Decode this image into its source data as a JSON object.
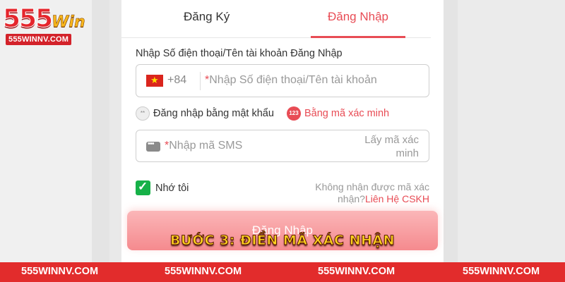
{
  "logo": {
    "brand_number": "555",
    "brand_word": "Win",
    "domain": "555WINNV.COM"
  },
  "tabs": {
    "register_label": "Đăng Ký",
    "login_label": "Đăng Nhập"
  },
  "form": {
    "account_label": "Nhập Số điện thoại/Tên tài khoản Đăng Nhập",
    "country_code": "+84",
    "required_mark": "*",
    "account_placeholder": "Nhập Số điện thoại/Tên tài khoản",
    "password_login_option": "Đăng nhập bằng mật khẩu",
    "password_icon_text": "**",
    "code_login_option": "Bằng mã xác minh",
    "code_icon_text": "123",
    "sms_placeholder": "Nhập mã SMS",
    "get_code_label": "Lấy mã xác minh",
    "remember_label": "Nhớ tôi",
    "no_code_text": "Không nhận được mã xác nhận?",
    "contact_link": "Liên Hệ CSKH",
    "submit_label": "Đăng Nhập"
  },
  "caption": "BƯỚC 3: ĐIỀN MÃ XÁC NHẬN",
  "footer": {
    "items": [
      "555WINNV.COM",
      "555WINNV.COM",
      "555WINNV.COM",
      "555WINNV.COM"
    ]
  },
  "colors": {
    "accent": "#e84c55",
    "check_green": "#16b148",
    "footer_red": "#e22c2c",
    "caption_yellow": "#ffd21f"
  },
  "icons": {
    "flag": "vietnam-flag-icon",
    "password": "password-dots-icon",
    "code": "verification-code-icon",
    "sms": "sms-message-icon",
    "checkbox": "checkmark-icon"
  }
}
